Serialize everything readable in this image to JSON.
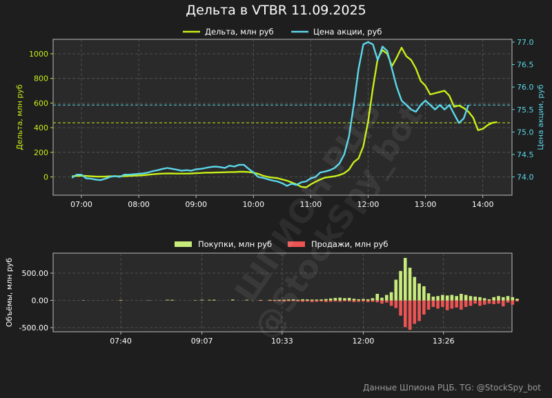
{
  "title": "Дельта в VTBR 11.09.2025",
  "footer": "Данные Шпиона РЦБ. TG: @StockSpy_bot",
  "watermark": [
    "ШПИОН РЦБ",
    "@StockSpy_bot"
  ],
  "colors": {
    "delta": "#c8f018",
    "price": "#5cd8ec",
    "buy": "#c8ec7c",
    "sell": "#ec5454",
    "panel": "#2a2a2a",
    "grid": "#5a5a5a"
  },
  "chart_data": [
    {
      "type": "line",
      "title": "",
      "xlabel": "",
      "ylabel": "Дельта, млн руб",
      "y2label": "Цена акции, руб",
      "x_ticks": [
        "07:00",
        "08:00",
        "09:00",
        "10:00",
        "11:00",
        "12:00",
        "13:00",
        "14:00"
      ],
      "y_ticks": [
        0,
        200,
        400,
        600,
        800,
        1000
      ],
      "y2_ticks": [
        "74.0",
        "74.5",
        "75.0",
        "75.5",
        "76.0",
        "76.5",
        "77.0"
      ],
      "ylim": [
        -150,
        1100
      ],
      "y2lim": [
        73.7,
        77.1
      ],
      "grid": true,
      "legend": "top-center",
      "x": [
        "06:50",
        "06:55",
        "07:00",
        "07:05",
        "07:10",
        "07:15",
        "07:20",
        "07:25",
        "07:30",
        "07:35",
        "07:40",
        "07:45",
        "07:50",
        "07:55",
        "08:00",
        "08:05",
        "08:10",
        "08:15",
        "08:20",
        "08:25",
        "08:30",
        "08:35",
        "08:40",
        "08:45",
        "08:50",
        "08:55",
        "09:00",
        "09:05",
        "09:10",
        "09:15",
        "09:20",
        "09:25",
        "09:30",
        "09:35",
        "09:40",
        "09:45",
        "09:50",
        "09:55",
        "10:00",
        "10:05",
        "10:10",
        "10:15",
        "10:20",
        "10:25",
        "10:30",
        "10:35",
        "10:40",
        "10:45",
        "10:50",
        "10:55",
        "11:00",
        "11:05",
        "11:10",
        "11:15",
        "11:20",
        "11:25",
        "11:30",
        "11:35",
        "11:40",
        "11:45",
        "11:50",
        "11:55",
        "12:00",
        "12:05",
        "12:10",
        "12:15",
        "12:20",
        "12:25",
        "12:30",
        "12:35",
        "12:40",
        "12:45",
        "12:50",
        "12:55",
        "13:00",
        "13:05",
        "13:10",
        "13:15",
        "13:20",
        "13:25",
        "13:30",
        "13:35",
        "13:40",
        "13:45",
        "13:50",
        "13:55",
        "14:00",
        "14:05",
        "14:10",
        "14:15"
      ],
      "series": [
        {
          "name": "Дельта, млн руб",
          "axis": "left",
          "values": [
            5,
            8,
            10,
            8,
            5,
            3,
            2,
            3,
            5,
            5,
            5,
            6,
            8,
            10,
            12,
            14,
            18,
            22,
            25,
            27,
            28,
            28,
            27,
            27,
            27,
            28,
            30,
            32,
            35,
            35,
            36,
            37,
            38,
            40,
            40,
            42,
            42,
            40,
            35,
            25,
            10,
            0,
            -5,
            -10,
            -20,
            -30,
            -45,
            -60,
            -80,
            -85,
            -60,
            -40,
            -20,
            -5,
            0,
            5,
            15,
            30,
            60,
            120,
            150,
            250,
            450,
            720,
            960,
            1030,
            1000,
            900,
            970,
            1050,
            980,
            950,
            880,
            780,
            740,
            670,
            680,
            690,
            700,
            660,
            570,
            580,
            560,
            530,
            480,
            380,
            390,
            420,
            440,
            445
          ],
          "ref_line": 440
        },
        {
          "name": "Цена акции, руб",
          "axis": "right",
          "values": [
            73.98,
            74.05,
            74.05,
            73.97,
            73.96,
            73.94,
            73.93,
            73.96,
            74.0,
            74.02,
            74.0,
            74.05,
            74.05,
            74.06,
            74.07,
            74.08,
            74.1,
            74.13,
            74.15,
            74.18,
            74.2,
            74.18,
            74.16,
            74.14,
            74.15,
            74.14,
            74.17,
            74.18,
            74.2,
            74.22,
            74.23,
            74.22,
            74.2,
            74.25,
            74.23,
            74.27,
            74.27,
            74.18,
            74.1,
            74.0,
            73.98,
            73.95,
            73.92,
            73.9,
            73.86,
            73.8,
            73.85,
            73.82,
            73.88,
            73.9,
            73.97,
            74.0,
            74.1,
            74.12,
            74.15,
            74.2,
            74.3,
            74.5,
            74.9,
            75.6,
            76.4,
            76.95,
            77.0,
            76.95,
            76.6,
            76.9,
            76.8,
            76.4,
            76.0,
            75.7,
            75.6,
            75.5,
            75.45,
            75.6,
            75.7,
            75.6,
            75.5,
            75.6,
            75.5,
            75.6,
            75.4,
            75.2,
            75.3,
            75.6
          ]
        }
      ]
    },
    {
      "type": "bar",
      "title": "",
      "xlabel": "",
      "ylabel": "Объёмы, млн руб",
      "x_ticks": [
        "07:40",
        "09:07",
        "10:33",
        "12:00",
        "13:26"
      ],
      "y_ticks": [
        "500.00",
        "0.00",
        "-500.00"
      ],
      "ylim": [
        -560,
        560
      ],
      "grid": true,
      "legend": "top-center",
      "series": [
        {
          "name": "Покупки, млн руб",
          "points": [
            [
              "07:00",
              5
            ],
            [
              "07:40",
              8
            ],
            [
              "08:10",
              5
            ],
            [
              "08:30",
              12
            ],
            [
              "08:35",
              10
            ],
            [
              "09:00",
              6
            ],
            [
              "09:07",
              12
            ],
            [
              "09:15",
              10
            ],
            [
              "09:20",
              12
            ],
            [
              "09:40",
              15
            ],
            [
              "09:55",
              12
            ],
            [
              "10:10",
              8
            ],
            [
              "10:20",
              10
            ],
            [
              "10:25",
              8
            ],
            [
              "10:30",
              10
            ],
            [
              "10:35",
              12
            ],
            [
              "10:40",
              15
            ],
            [
              "10:45",
              18
            ],
            [
              "10:50",
              12
            ],
            [
              "10:55",
              20
            ],
            [
              "11:00",
              18
            ],
            [
              "11:05",
              15
            ],
            [
              "11:10",
              15
            ],
            [
              "11:15",
              18
            ],
            [
              "11:20",
              25
            ],
            [
              "11:25",
              35
            ],
            [
              "11:30",
              45
            ],
            [
              "11:35",
              50
            ],
            [
              "11:40",
              40
            ],
            [
              "11:45",
              45
            ],
            [
              "11:50",
              30
            ],
            [
              "11:55",
              20
            ],
            [
              "12:00",
              25
            ],
            [
              "12:05",
              20
            ],
            [
              "12:10",
              40
            ],
            [
              "12:15",
              120
            ],
            [
              "12:20",
              50
            ],
            [
              "12:25",
              100
            ],
            [
              "12:30",
              150
            ],
            [
              "12:35",
              380
            ],
            [
              "12:40",
              540
            ],
            [
              "12:45",
              780
            ],
            [
              "12:50",
              600
            ],
            [
              "12:55",
              430
            ],
            [
              "13:00",
              310
            ],
            [
              "13:05",
              260
            ],
            [
              "13:10",
              130
            ],
            [
              "13:15",
              70
            ],
            [
              "13:20",
              80
            ],
            [
              "13:25",
              100
            ],
            [
              "13:30",
              90
            ],
            [
              "13:35",
              100
            ],
            [
              "13:40",
              80
            ],
            [
              "13:45",
              120
            ],
            [
              "13:50",
              100
            ],
            [
              "13:55",
              80
            ],
            [
              "14:00",
              70
            ],
            [
              "14:05",
              60
            ],
            [
              "14:10",
              40
            ],
            [
              "14:15",
              20
            ],
            [
              "14:20",
              60
            ],
            [
              "14:25",
              80
            ],
            [
              "14:30",
              60
            ],
            [
              "14:35",
              80
            ],
            [
              "14:40",
              60
            ],
            [
              "14:45",
              30
            ]
          ]
        },
        {
          "name": "Продажи, млн руб",
          "points": [
            [
              "07:40",
              -5
            ],
            [
              "08:35",
              -5
            ],
            [
              "09:20",
              -5
            ],
            [
              "10:10",
              -8
            ],
            [
              "10:20",
              -10
            ],
            [
              "10:25",
              -12
            ],
            [
              "10:30",
              -15
            ],
            [
              "10:35",
              -20
            ],
            [
              "10:40",
              -15
            ],
            [
              "10:45",
              -10
            ],
            [
              "10:50",
              -20
            ],
            [
              "10:55",
              -25
            ],
            [
              "11:00",
              -20
            ],
            [
              "11:05",
              -30
            ],
            [
              "11:10",
              -25
            ],
            [
              "11:15",
              -20
            ],
            [
              "11:20",
              -30
            ],
            [
              "11:25",
              -25
            ],
            [
              "11:30",
              -20
            ],
            [
              "11:35",
              -25
            ],
            [
              "11:40",
              -15
            ],
            [
              "11:45",
              -20
            ],
            [
              "11:50",
              -30
            ],
            [
              "11:55",
              -25
            ],
            [
              "12:00",
              -20
            ],
            [
              "12:05",
              -30
            ],
            [
              "12:10",
              -25
            ],
            [
              "12:15",
              -35
            ],
            [
              "12:20",
              -60
            ],
            [
              "12:25",
              -40
            ],
            [
              "12:30",
              -100
            ],
            [
              "12:35",
              -140
            ],
            [
              "12:40",
              -280
            ],
            [
              "12:45",
              -490
            ],
            [
              "12:50",
              -540
            ],
            [
              "12:55",
              -430
            ],
            [
              "13:00",
              -380
            ],
            [
              "13:05",
              -260
            ],
            [
              "13:10",
              -170
            ],
            [
              "13:15",
              -120
            ],
            [
              "13:20",
              -150
            ],
            [
              "13:25",
              -120
            ],
            [
              "13:30",
              -180
            ],
            [
              "13:35",
              -150
            ],
            [
              "13:40",
              -130
            ],
            [
              "13:45",
              -170
            ],
            [
              "13:50",
              -120
            ],
            [
              "13:55",
              -100
            ],
            [
              "14:00",
              -60
            ],
            [
              "14:05",
              -100
            ],
            [
              "14:10",
              -80
            ],
            [
              "14:15",
              -60
            ],
            [
              "14:20",
              -70
            ],
            [
              "14:25",
              -60
            ],
            [
              "14:30",
              -110
            ],
            [
              "14:35",
              -40
            ],
            [
              "14:40",
              -80
            ],
            [
              "14:45",
              -20
            ]
          ]
        }
      ]
    }
  ]
}
